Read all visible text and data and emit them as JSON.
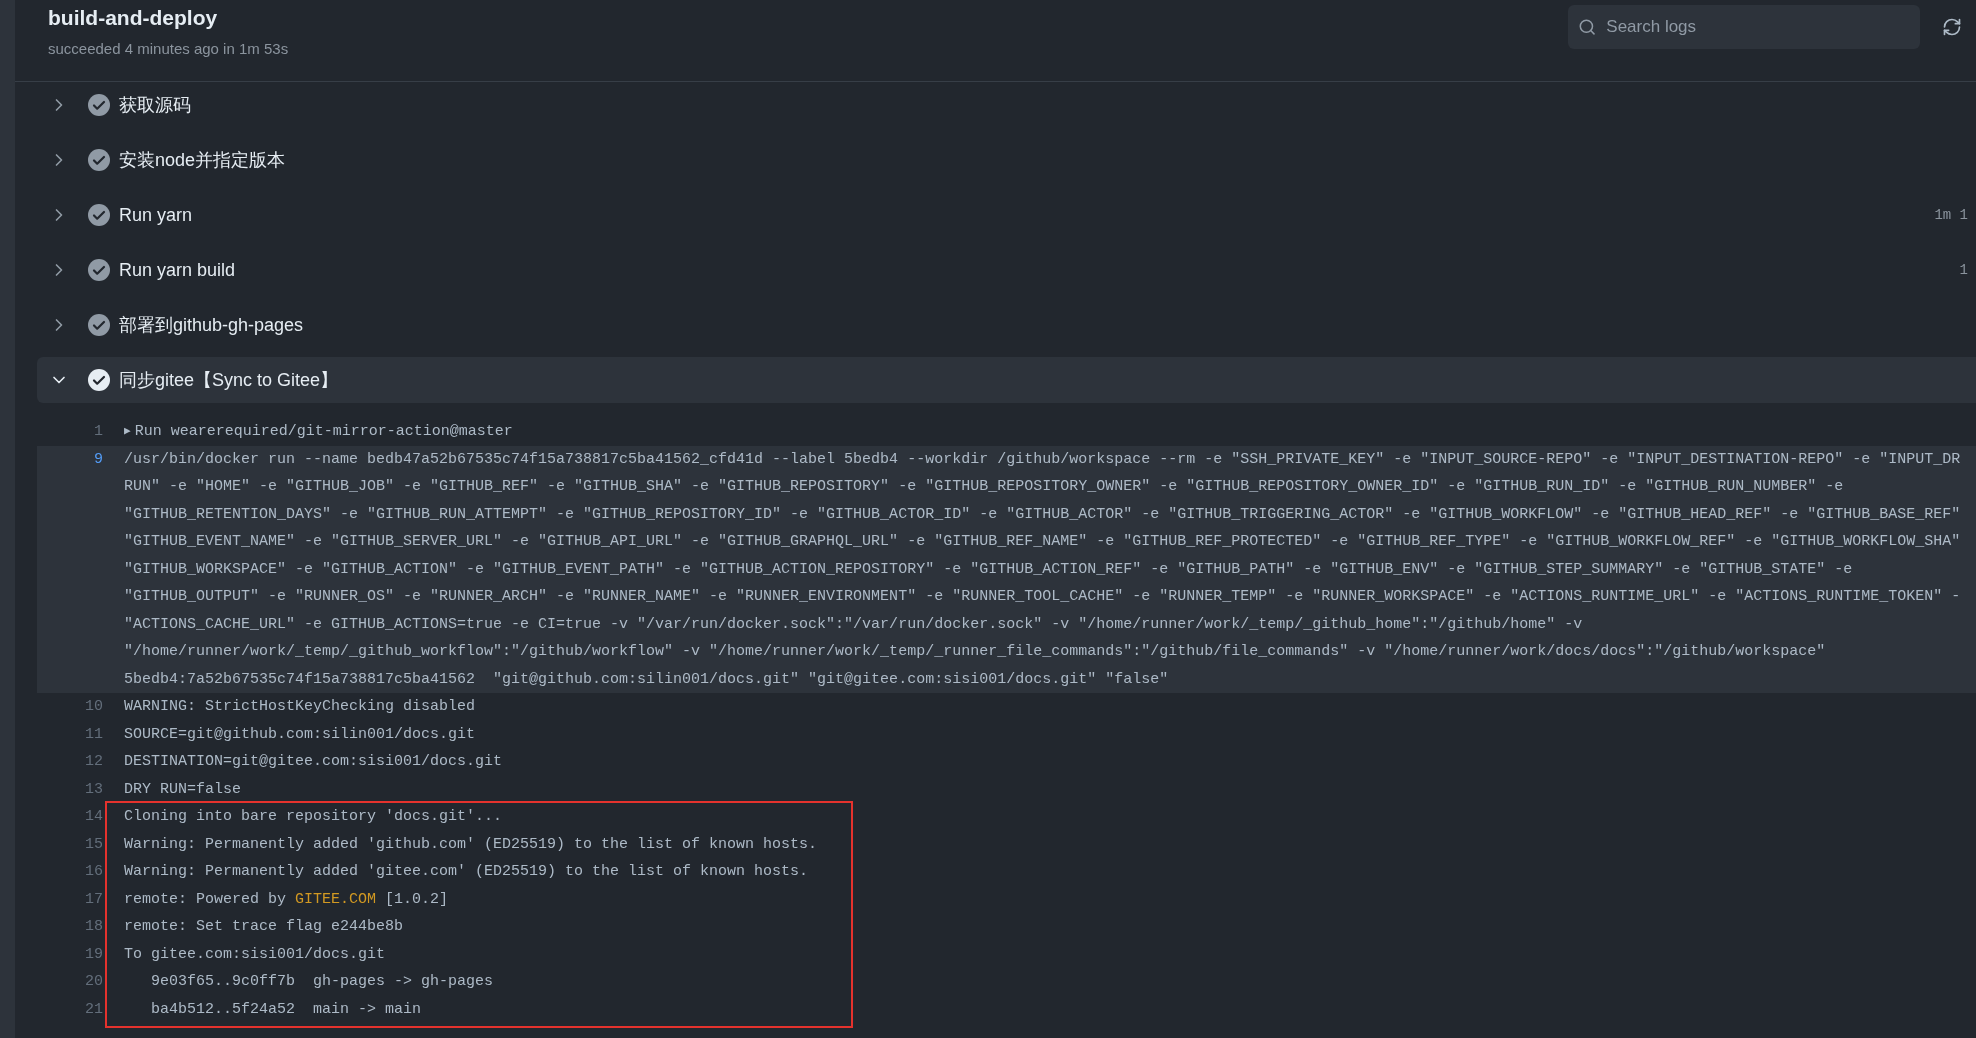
{
  "header": {
    "title": "build-and-deploy",
    "subtitle": "succeeded 4 minutes ago in 1m 53s",
    "search": {
      "placeholder": "Search logs"
    }
  },
  "steps": [
    {
      "label": "获取源码",
      "succeeded": true,
      "expanded": false
    },
    {
      "label": "安装node并指定版本",
      "succeeded": true,
      "expanded": false
    },
    {
      "label": "Run yarn",
      "succeeded": true,
      "expanded": false,
      "duration": "1m 1"
    },
    {
      "label": "Run yarn build",
      "succeeded": true,
      "expanded": false,
      "duration": "1"
    },
    {
      "label": "部署到github-gh-pages",
      "succeeded": true,
      "expanded": false
    },
    {
      "label": "同步gitee【Sync to Gitee】",
      "succeeded": true,
      "expanded": true
    }
  ],
  "log": [
    {
      "framed": false,
      "lines": [
        {
          "number": "1",
          "toggle": "▶",
          "selected": false,
          "rows": [
            "Run wearerequired/git-mirror-action@master"
          ]
        },
        {
          "number": "9",
          "selected": true,
          "rows": [
            "/usr/bin/docker run --name bedb47a52b67535c74f15a738817c5ba41562_cfd41d --label 5bedb4 --workdir /github/workspace --rm -e \"SSH_PRIVATE_KEY\" -e \"INPUT_SOURCE-REPO\" -e \"INPUT_DESTINATION-REPO\" -e \"INPUT_DR",
            "RUN\" -e \"HOME\" -e \"GITHUB_JOB\" -e \"GITHUB_REF\" -e \"GITHUB_SHA\" -e \"GITHUB_REPOSITORY\" -e \"GITHUB_REPOSITORY_OWNER\" -e \"GITHUB_REPOSITORY_OWNER_ID\" -e \"GITHUB_RUN_ID\" -e \"GITHUB_RUN_NUMBER\" -e",
            "\"GITHUB_RETENTION_DAYS\" -e \"GITHUB_RUN_ATTEMPT\" -e \"GITHUB_REPOSITORY_ID\" -e \"GITHUB_ACTOR_ID\" -e \"GITHUB_ACTOR\" -e \"GITHUB_TRIGGERING_ACTOR\" -e \"GITHUB_WORKFLOW\" -e \"GITHUB_HEAD_REF\" -e \"GITHUB_BASE_REF\"",
            "\"GITHUB_EVENT_NAME\" -e \"GITHUB_SERVER_URL\" -e \"GITHUB_API_URL\" -e \"GITHUB_GRAPHQL_URL\" -e \"GITHUB_REF_NAME\" -e \"GITHUB_REF_PROTECTED\" -e \"GITHUB_REF_TYPE\" -e \"GITHUB_WORKFLOW_REF\" -e \"GITHUB_WORKFLOW_SHA\"",
            "\"GITHUB_WORKSPACE\" -e \"GITHUB_ACTION\" -e \"GITHUB_EVENT_PATH\" -e \"GITHUB_ACTION_REPOSITORY\" -e \"GITHUB_ACTION_REF\" -e \"GITHUB_PATH\" -e \"GITHUB_ENV\" -e \"GITHUB_STEP_SUMMARY\" -e \"GITHUB_STATE\" -e",
            "\"GITHUB_OUTPUT\" -e \"RUNNER_OS\" -e \"RUNNER_ARCH\" -e \"RUNNER_NAME\" -e \"RUNNER_ENVIRONMENT\" -e \"RUNNER_TOOL_CACHE\" -e \"RUNNER_TEMP\" -e \"RUNNER_WORKSPACE\" -e \"ACTIONS_RUNTIME_URL\" -e \"ACTIONS_RUNTIME_TOKEN\" -",
            "\"ACTIONS_CACHE_URL\" -e GITHUB_ACTIONS=true -e CI=true -v \"/var/run/docker.sock\":\"/var/run/docker.sock\" -v \"/home/runner/work/_temp/_github_home\":\"/github/home\" -v",
            "\"/home/runner/work/_temp/_github_workflow\":\"/github/workflow\" -v \"/home/runner/work/_temp/_runner_file_commands\":\"/github/file_commands\" -v \"/home/runner/work/docs/docs\":\"/github/workspace\"",
            "5bedb4:7a52b67535c74f15a738817c5ba41562  \"git@github.com:silin001/docs.git\" \"git@gitee.com:sisi001/docs.git\" \"false\""
          ]
        },
        {
          "number": "10",
          "selected": false,
          "rows": [
            "WARNING: StrictHostKeyChecking disabled"
          ]
        },
        {
          "number": "11",
          "selected": false,
          "rows": [
            "SOURCE=git@github.com:silin001/docs.git"
          ]
        },
        {
          "number": "12",
          "selected": false,
          "rows": [
            "DESTINATION=git@gitee.com:sisi001/docs.git"
          ]
        },
        {
          "number": "13",
          "selected": false,
          "rows": [
            "DRY RUN=false"
          ]
        }
      ]
    },
    {
      "framed": true,
      "lines": [
        {
          "number": "14",
          "selected": false,
          "rows": [
            "Cloning into bare repository 'docs.git'..."
          ]
        },
        {
          "number": "15",
          "selected": false,
          "rows": [
            "Warning: Permanently added 'github.com' (ED25519) to the list of known hosts."
          ]
        },
        {
          "number": "16",
          "selected": false,
          "rows": [
            "Warning: Permanently added 'gitee.com' (ED25519) to the list of known hosts."
          ]
        },
        {
          "number": "17",
          "selected": false,
          "parts": [
            {
              "text": "remote: Powered by "
            },
            {
              "text": "GITEE.COM",
              "color": "#d29922"
            },
            {
              "text": " [1.0.2]"
            }
          ]
        },
        {
          "number": "18",
          "selected": false,
          "rows": [
            "remote: Set trace flag e244be8b"
          ]
        },
        {
          "number": "19",
          "selected": false,
          "rows": [
            "To gitee.com:sisi001/docs.git"
          ]
        },
        {
          "number": "20",
          "selected": false,
          "rows": [
            "   9e03f65..9c0ff7b  gh-pages -> gh-pages"
          ]
        },
        {
          "number": "21",
          "selected": false,
          "rows": [
            "   ba4b512..5f24a52  main -> main"
          ]
        }
      ]
    }
  ]
}
